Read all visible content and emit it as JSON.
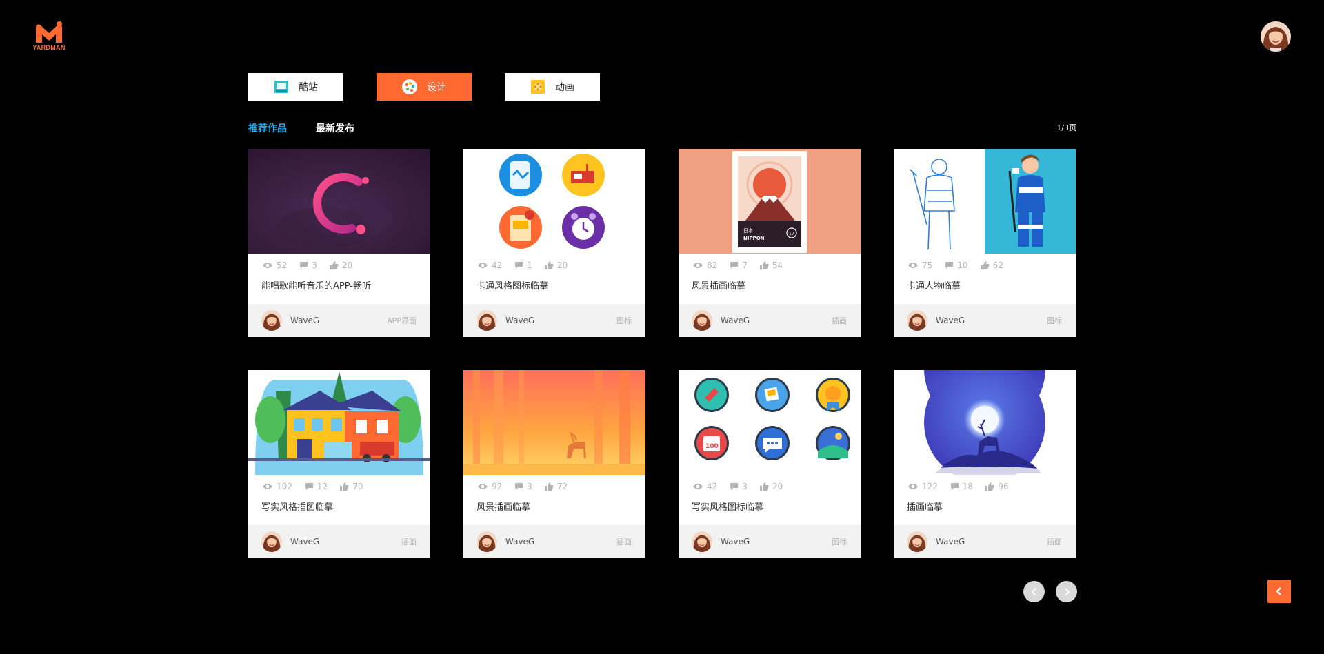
{
  "brand": {
    "logo_text": "YARDMAN",
    "accent": "#ff6a33"
  },
  "categories": [
    {
      "label": "酷站",
      "icon": "monitor-icon",
      "active": false
    },
    {
      "label": "设计",
      "icon": "palette-icon",
      "active": true
    },
    {
      "label": "动画",
      "icon": "film-reel-icon",
      "active": false
    }
  ],
  "tabs": [
    {
      "label": "推荐作品",
      "active": true
    },
    {
      "label": "最新发布",
      "active": false
    }
  ],
  "page_indicator": "1/3页",
  "cards": [
    {
      "views": "52",
      "comments": "3",
      "likes": "20",
      "title": "能唱歌能听音乐的APP-畅听",
      "author": "WaveG",
      "tag": "APP界面",
      "thumb": "music-app-thumb"
    },
    {
      "views": "42",
      "comments": "1",
      "likes": "20",
      "title": "卡通风格图标临摹",
      "author": "WaveG",
      "tag": "图标",
      "thumb": "cartoon-icons-thumb"
    },
    {
      "views": "82",
      "comments": "7",
      "likes": "54",
      "title": "风景插画临摹",
      "author": "WaveG",
      "tag": "插画",
      "thumb": "nippon-stamp-thumb",
      "thumb_text": [
        "日本",
        "NIPPON",
        "17"
      ]
    },
    {
      "views": "75",
      "comments": "10",
      "likes": "62",
      "title": "卡通人物临摹",
      "author": "WaveG",
      "tag": "图标",
      "thumb": "hockey-players-thumb"
    },
    {
      "views": "102",
      "comments": "12",
      "likes": "70",
      "title": "写实风格插图临摹",
      "author": "WaveG",
      "tag": "插画",
      "thumb": "house-thumb"
    },
    {
      "views": "92",
      "comments": "3",
      "likes": "72",
      "title": "风景插画临摹",
      "author": "WaveG",
      "tag": "插画",
      "thumb": "forest-deer-thumb"
    },
    {
      "views": "42",
      "comments": "3",
      "likes": "20",
      "title": "写实风格图标临摹",
      "author": "WaveG",
      "tag": "图标",
      "thumb": "flat-icons-thumb",
      "thumb_text": [
        "100"
      ]
    },
    {
      "views": "122",
      "comments": "18",
      "likes": "96",
      "title": "插画临摹",
      "author": "WaveG",
      "tag": "插画",
      "thumb": "moon-deer-thumb"
    }
  ],
  "pagination": {
    "prev_icon": "chevron-left-icon",
    "next_icon": "chevron-right-icon"
  },
  "back_button": {
    "icon": "chevron-left-icon"
  }
}
